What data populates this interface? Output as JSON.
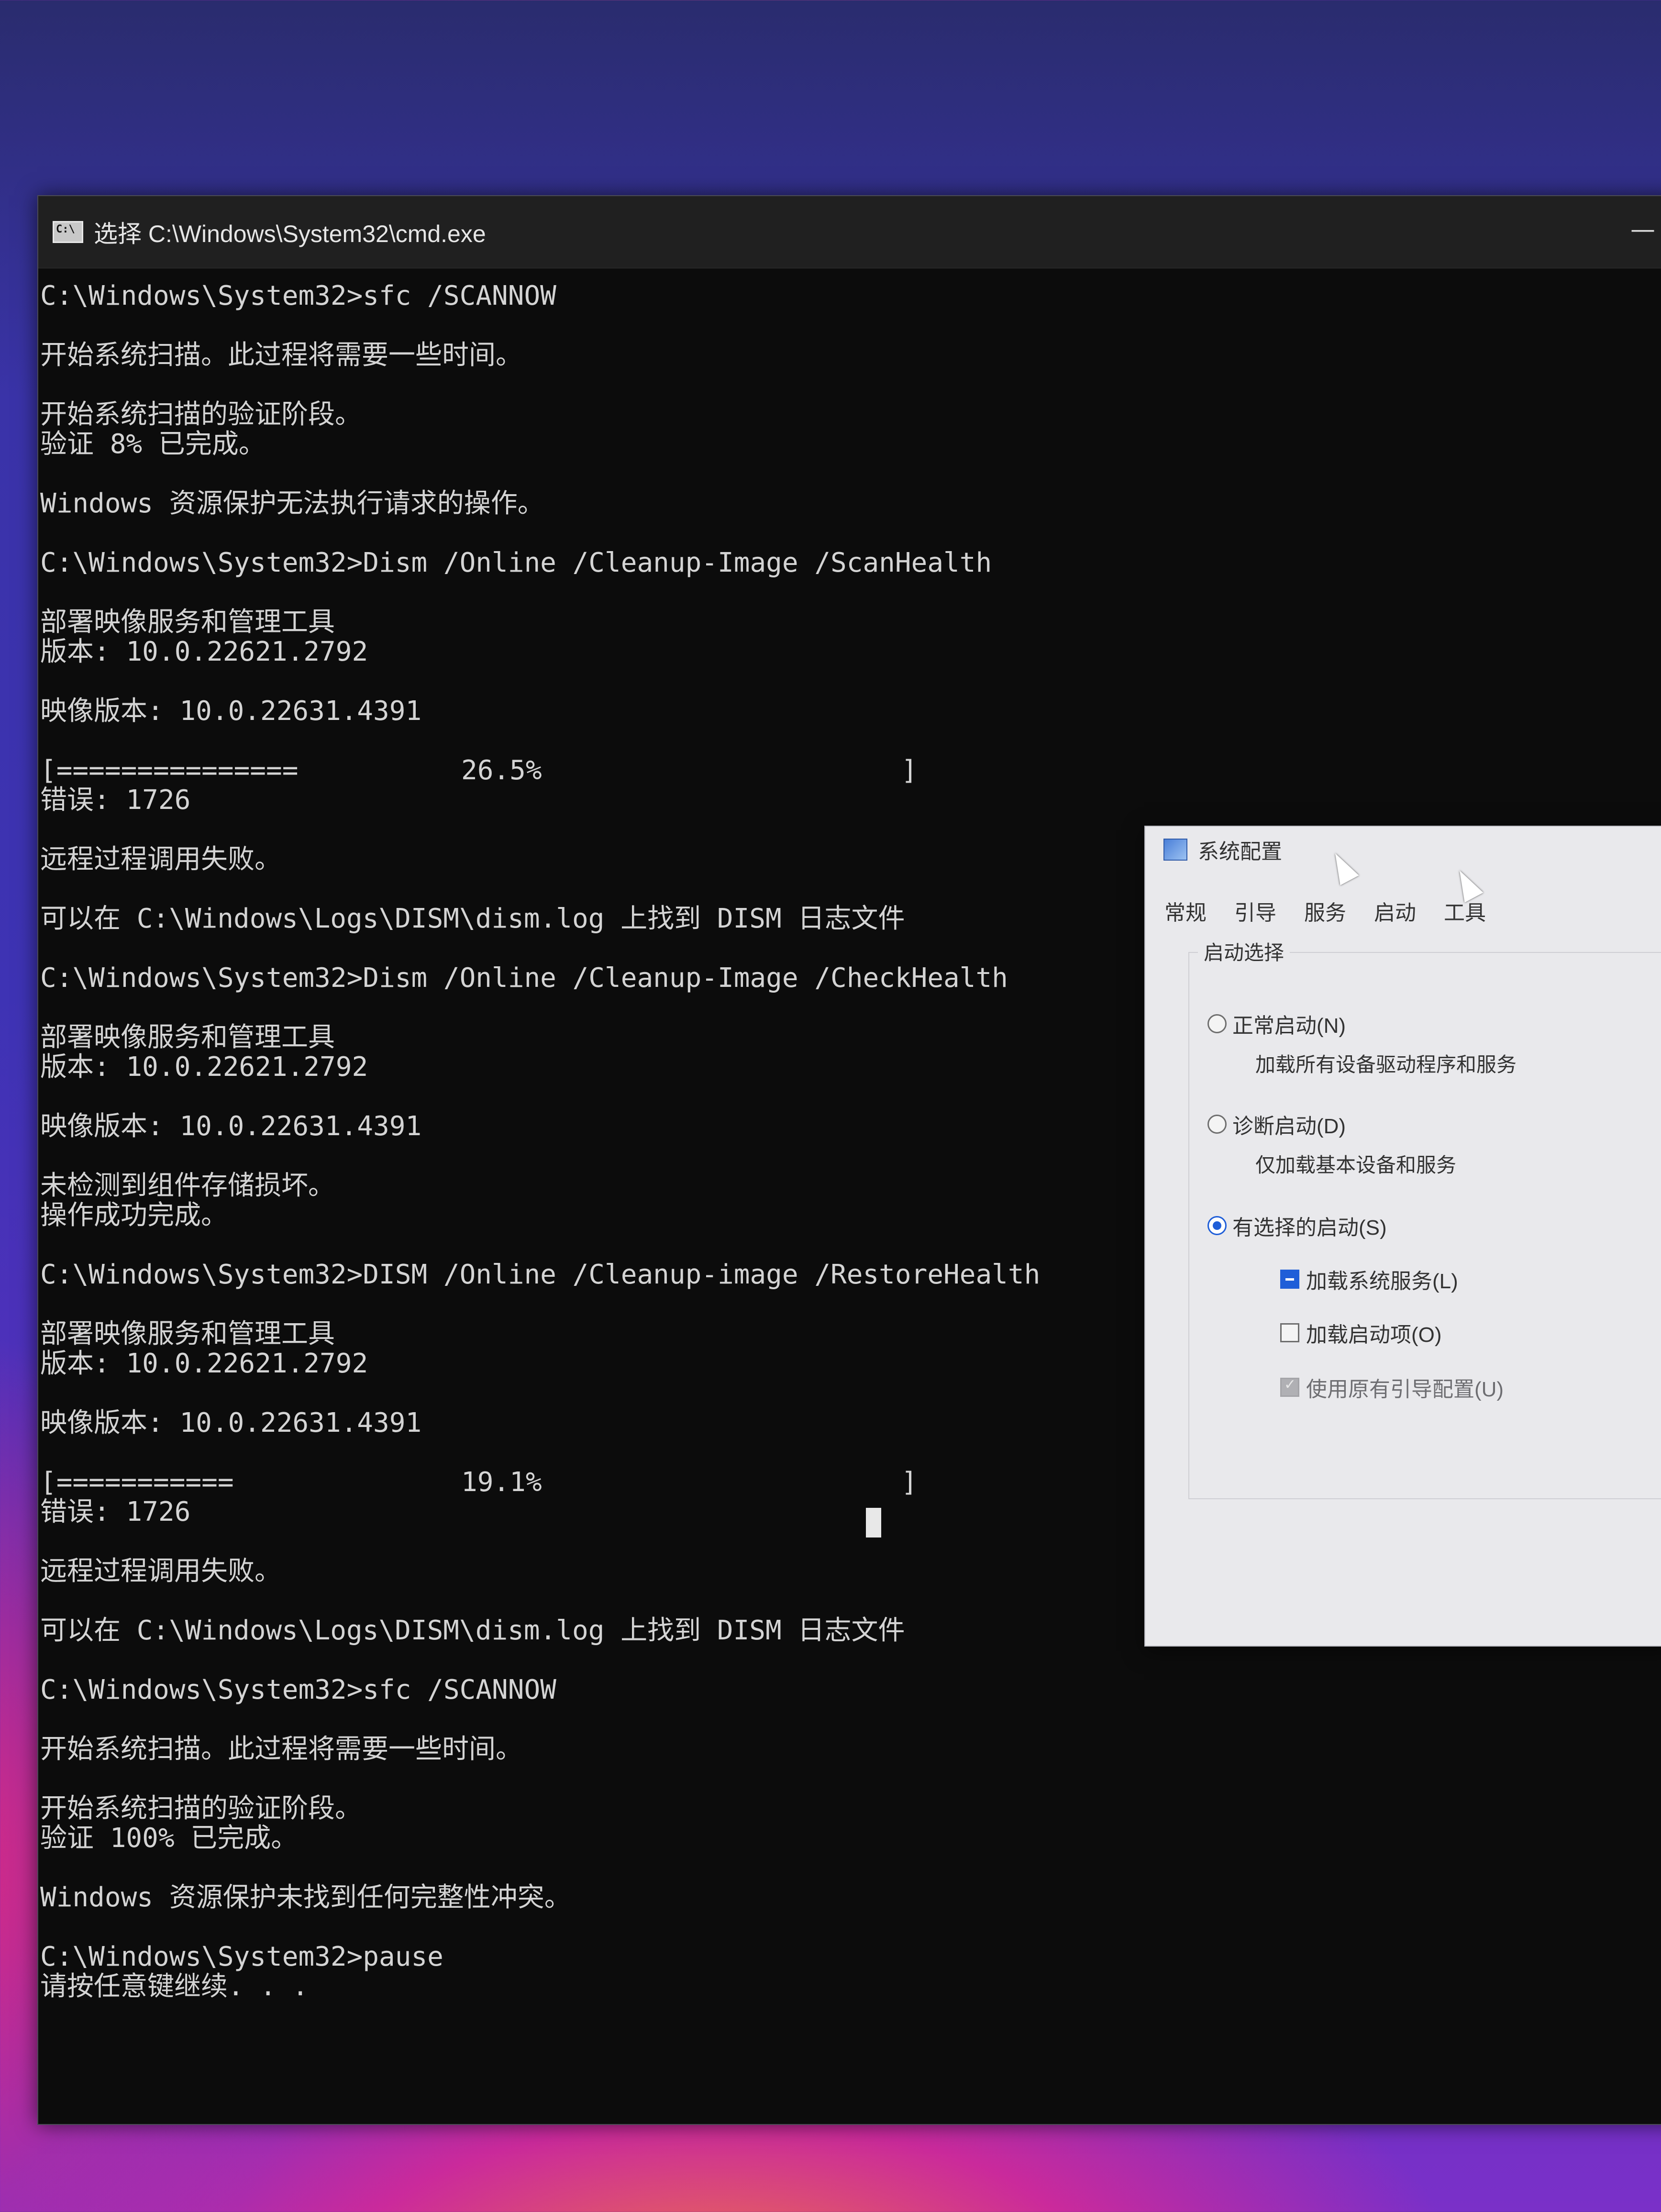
{
  "cmd": {
    "title": "选择 C:\\Windows\\System32\\cmd.exe",
    "minimize": "—",
    "lines": [
      "C:\\Windows\\System32>sfc /SCANNOW",
      "",
      "开始系统扫描。此过程将需要一些时间。",
      "",
      "开始系统扫描的验证阶段。",
      "验证 8% 已完成。",
      "",
      "Windows 资源保护无法执行请求的操作。",
      "",
      "C:\\Windows\\System32>Dism /Online /Cleanup-Image /ScanHealth",
      "",
      "部署映像服务和管理工具",
      "版本: 10.0.22621.2792",
      "",
      "映像版本: 10.0.22631.4391",
      "",
      "__PROGRESS1__",
      "错误: 1726",
      "",
      "远程过程调用失败。",
      "",
      "可以在 C:\\Windows\\Logs\\DISM\\dism.log 上找到 DISM 日志文件",
      "",
      "C:\\Windows\\System32>Dism /Online /Cleanup-Image /CheckHealth",
      "",
      "部署映像服务和管理工具",
      "版本: 10.0.22621.2792",
      "",
      "映像版本: 10.0.22631.4391",
      "",
      "未检测到组件存储损坏。",
      "操作成功完成。",
      "",
      "C:\\Windows\\System32>DISM /Online /Cleanup-image /RestoreHealth",
      "",
      "部署映像服务和管理工具",
      "版本: 10.0.22621.2792",
      "",
      "映像版本: 10.0.22631.4391",
      "",
      "__PROGRESS2__",
      "错误: 1726",
      "",
      "远程过程调用失败。",
      "",
      "可以在 C:\\Windows\\Logs\\DISM\\dism.log 上找到 DISM 日志文件",
      "",
      "C:\\Windows\\System32>sfc /SCANNOW",
      "",
      "开始系统扫描。此过程将需要一些时间。",
      "",
      "开始系统扫描的验证阶段。",
      "验证 100% 已完成。",
      "",
      "Windows 资源保护未找到任何完整性冲突。",
      "",
      "C:\\Windows\\System32>pause",
      "请按任意键继续. . ."
    ],
    "progress1": {
      "bar": "[===============",
      "percent": "26.5%",
      "end": "]",
      "fraction": 0.265
    },
    "progress2": {
      "bar": "[===========",
      "percent": "19.1%",
      "end": "]",
      "fraction": 0.191
    }
  },
  "dialog": {
    "title": "系统配置",
    "tabs": [
      "常规",
      "引导",
      "服务",
      "启动",
      "工具"
    ],
    "group_label": "启动选择",
    "normal_label": "正常启动(N)",
    "normal_desc": "加载所有设备驱动程序和服务",
    "diag_label": "诊断启动(D)",
    "diag_desc": "仅加载基本设备和服务",
    "selective_label": "有选择的启动(S)",
    "load_services_label": "加载系统服务(L)",
    "load_startup_label": "加载启动项(O)",
    "use_boot_label": "使用原有引导配置(U)"
  }
}
